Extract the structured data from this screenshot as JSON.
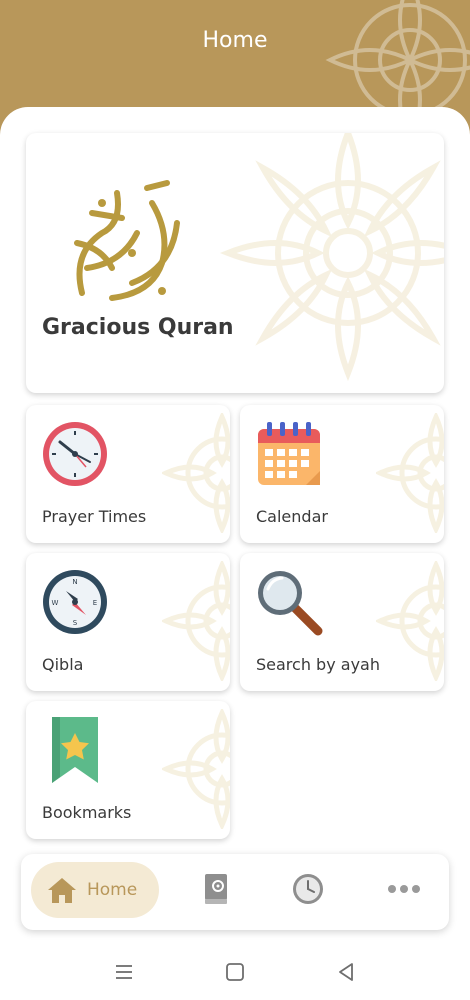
{
  "header": {
    "title": "Home"
  },
  "hero": {
    "title": "Gracious Quran"
  },
  "tiles": [
    {
      "label": "Prayer Times",
      "icon": "clock-icon"
    },
    {
      "label": "Calendar",
      "icon": "calendar-icon"
    },
    {
      "label": "Qibla",
      "icon": "compass-icon"
    },
    {
      "label": "Search by ayah",
      "icon": "magnifier-icon"
    },
    {
      "label": "Bookmarks",
      "icon": "bookmark-icon"
    }
  ],
  "bottom_nav": {
    "home_label": "Home",
    "items": [
      "home-icon",
      "quran-book-icon",
      "clock-icon",
      "more-icon"
    ]
  },
  "colors": {
    "accent": "#b8975a",
    "accent_light": "#f4ead4"
  }
}
